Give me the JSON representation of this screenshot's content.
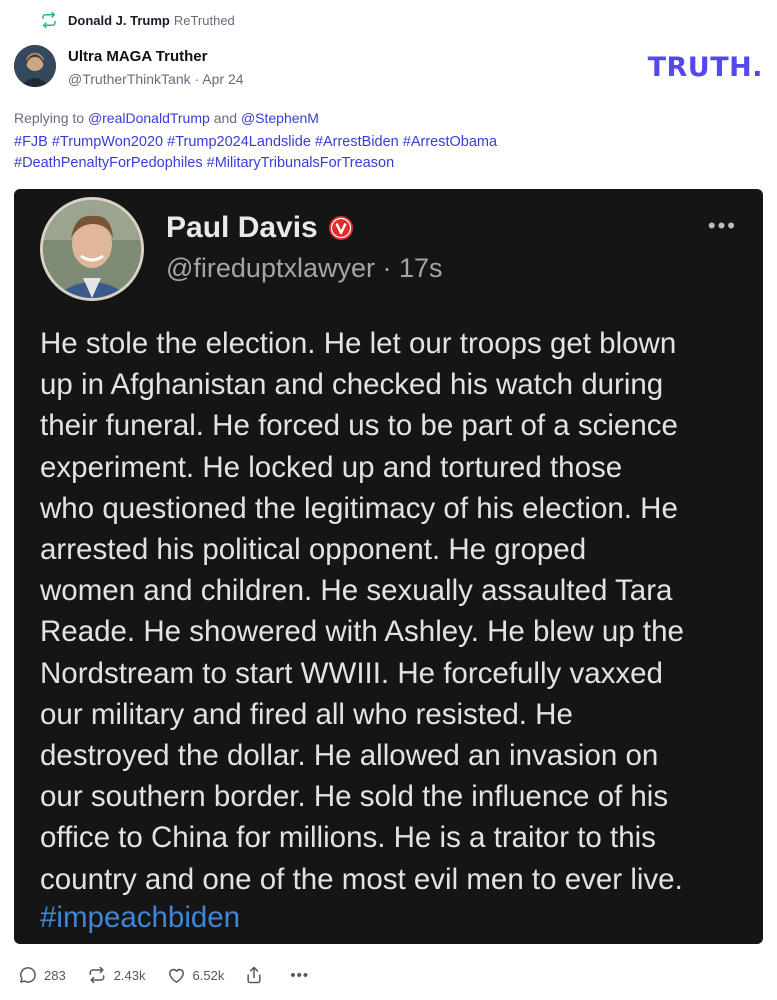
{
  "retruth": {
    "name": "Donald J. Trump",
    "label": "ReTruthed",
    "icon": "retruth-icon"
  },
  "author": {
    "name": "Ultra MAGA Truther",
    "handle": "@TrutherThinkTank",
    "date": "Apr 24"
  },
  "brand": {
    "text": "TRUTH",
    "suffix": ".",
    "color": "#5448ee"
  },
  "reply": {
    "prefix": "Replying to",
    "mention1": "@realDonaldTrump",
    "joiner": "and",
    "mention2": "@StephenM"
  },
  "hashtags": {
    "line1": "#FJB #TrumpWon2020 #Trump2024Landslide #ArrestBiden #ArrestObama",
    "line2": "#DeathPenaltyForPedophiles #MilitaryTribunalsForTreason"
  },
  "embedded_post": {
    "name": "Paul Davis",
    "handle": "@fireduptxlawyer · 17s",
    "more": "•••",
    "lines": [
      "He stole the election. He let our troops get blown",
      "up in Afghanistan and checked his watch during",
      "their funeral. He forced us to be part of a science",
      "experiment. He locked up and tortured those",
      "who questioned the legitimacy of his election. He",
      "arrested his political opponent. He groped",
      "women and children. He sexually assaulted Tara",
      "Reade. He showered with Ashley. He blew up the",
      "Nordstream to start WWIII. He forcefully vaxxed",
      "our military and fired all who resisted. He",
      "destroyed the dollar. He allowed an invasion on",
      "our southern border. He sold the influence of his",
      "office to China for millions. He is a traitor to this",
      "country and one of the most evil men to ever live."
    ],
    "hashtag": "#impeachbiden"
  },
  "actions": {
    "replies": "283",
    "retruths": "2.43k",
    "likes": "6.52k",
    "more": "•••"
  },
  "colors": {
    "link": "#3b3bd9",
    "muted": "#6b6b80",
    "embed_bg": "#151515"
  }
}
